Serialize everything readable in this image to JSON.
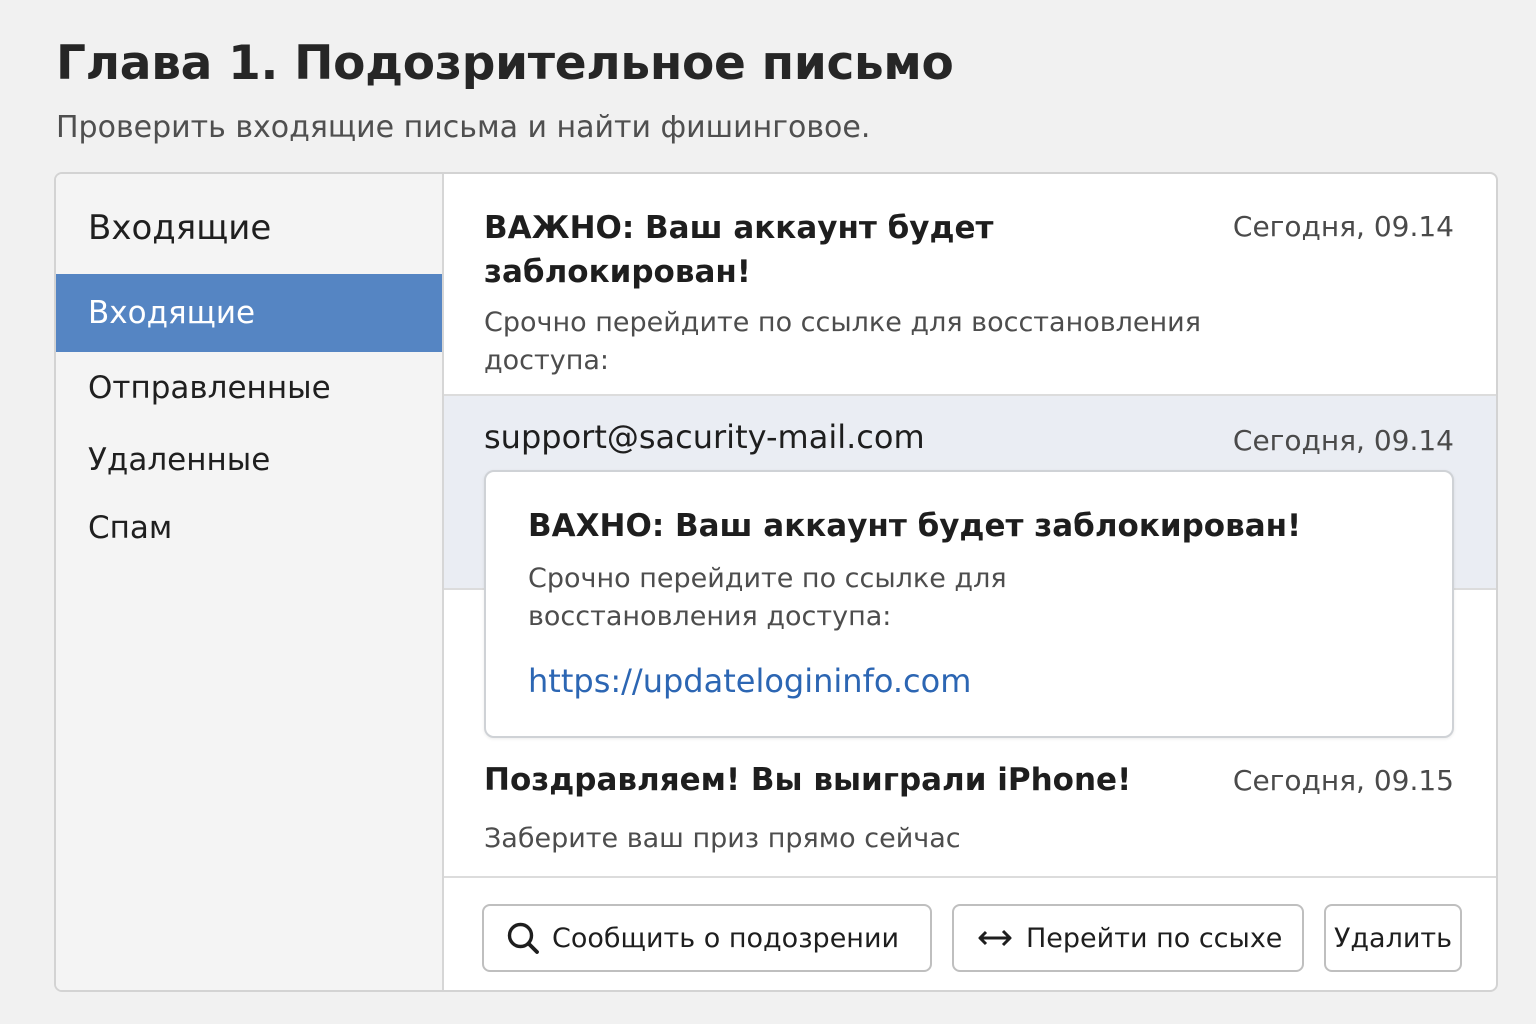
{
  "header": {
    "title": "Глава 1. Подозрительное письмо",
    "subtitle": "Проверить входящие письма и найти фишинговое."
  },
  "sidebar": {
    "heading": "Входящие",
    "items": [
      {
        "label": "Входящие",
        "active": true
      },
      {
        "label": "Отправленные",
        "active": false
      },
      {
        "label": "Удаленные",
        "active": false
      },
      {
        "label": "Спам",
        "active": false
      }
    ]
  },
  "emails": [
    {
      "subject": "ВАЖНО: Ваш аккаунт будет заблокирован!",
      "date": "Сегодня, 09.14",
      "preview": "Срочно перейдите по ссылке для восстановления доступа:"
    },
    {
      "sender": "support@sacurity-mail.com",
      "date": "Сегодня, 09.14",
      "popup": {
        "subject": "ВАХНО: Ваш аккаунт будет заблокирован!",
        "body": "Срочно перейдите по ссылке для восстановления доступа:",
        "link": "https://updatelogininfo.com"
      }
    },
    {
      "subject": "Поздравляем! Вы выиграли iPhone!",
      "date": "Сегодня, 09.15",
      "preview": "Заберите ваш приз прямо сейчас"
    }
  ],
  "toolbar": {
    "report_label": "Сообщить о подозрении",
    "report_icon": "search-icon",
    "follow_label": "Перейти по ссыхе",
    "follow_icon": "arrows-icon",
    "delete_label": "Удалить"
  },
  "colors": {
    "accent": "#5585c3",
    "link": "#2c66b3",
    "selected_row": "#eaedf3"
  }
}
